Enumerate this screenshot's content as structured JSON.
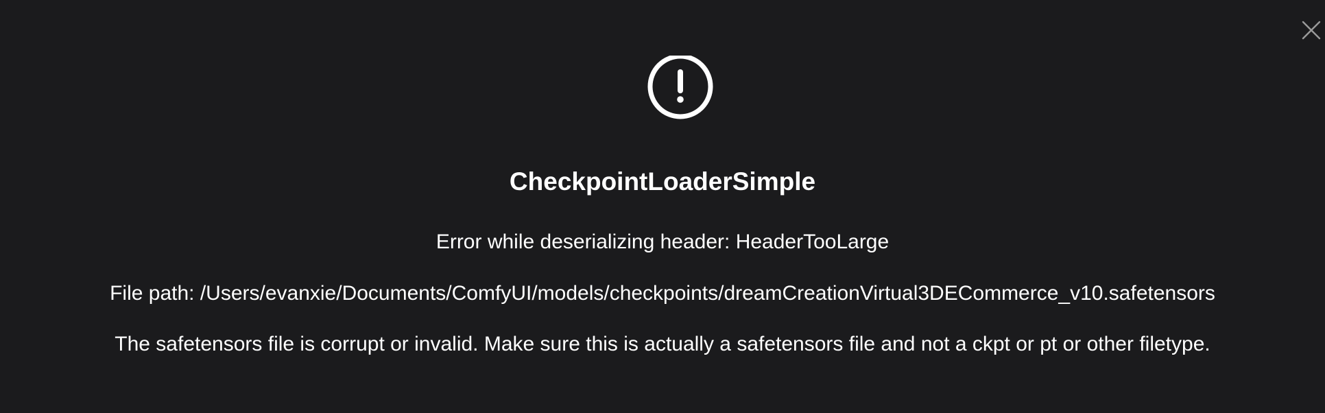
{
  "dialog": {
    "background": "#1b1b1d",
    "icon": "exclamation-circle-icon",
    "close_icon": "close-icon",
    "title": "CheckpointLoaderSimple",
    "messages": [
      "Error while deserializing header: HeaderTooLarge",
      "File path: /Users/evanxie/Documents/ComfyUI/models/checkpoints/dreamCreationVirtual3DECommerce_v10.safetensors",
      "The safetensors file is corrupt or invalid. Make sure this is actually a safetensors file and not a ckpt or pt or other filetype."
    ]
  }
}
